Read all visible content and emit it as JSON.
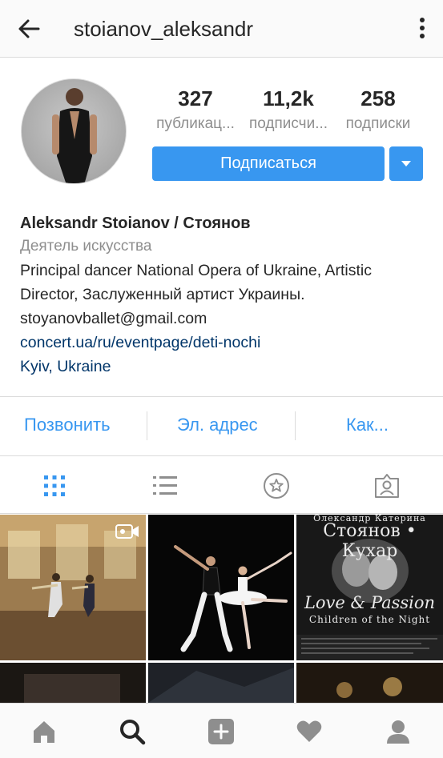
{
  "header": {
    "title": "stoianov_aleksandr",
    "back_icon": "arrow-left-icon",
    "menu_icon": "more-vertical-icon"
  },
  "stats": [
    {
      "value": "327",
      "label": "публикац..."
    },
    {
      "value": "11,2k",
      "label": "подписчи..."
    },
    {
      "value": "258",
      "label": "подписки"
    }
  ],
  "follow_button": {
    "label": "Подписаться"
  },
  "bio": {
    "name": "Aleksandr Stoianov / Стоянов",
    "category": "Деятель искусства",
    "line1": "Principal dancer National Opera of Ukraine, Artistic",
    "line2": "Director, Заслуженный артист Украины.",
    "email": "stoyanovballet@gmail.com",
    "website": "concert.ua/ru/eventpage/deti-nochi",
    "location": "Kyiv, Ukraine"
  },
  "actions": {
    "call": "Позвонить",
    "email": "Эл. адрес",
    "directions": "Как..."
  },
  "tabs": [
    "grid-icon",
    "list-icon",
    "star-icon",
    "tagged-icon"
  ],
  "posts": {
    "poster": {
      "names": "Олександр        Катерина",
      "top": "Стоянов • Кухар",
      "title1": "Love & Passion",
      "title2": "Children of the Night"
    }
  },
  "nav": [
    "home-icon",
    "search-icon",
    "add-icon",
    "heart-icon",
    "profile-icon"
  ],
  "colors": {
    "accent": "#3897f0",
    "link": "#003569",
    "muted": "#8e8e8e",
    "text": "#262626"
  }
}
